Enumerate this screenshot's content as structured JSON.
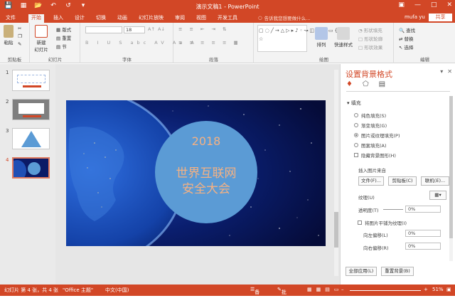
{
  "window": {
    "title": "演示文稿1 - PowerPoint",
    "user": "mufa yu",
    "share_label": "共享",
    "search_placeholder": "告诉我您想要做什么..."
  },
  "tabs": [
    "文件",
    "开始",
    "插入",
    "设计",
    "切换",
    "动画",
    "幻灯片放映",
    "审阅",
    "视图",
    "开发工具"
  ],
  "ribbon": {
    "groups": {
      "clipboard": "剪贴板",
      "slides": "幻灯片",
      "font": "字体",
      "paragraph": "段落",
      "drawing": "绘图",
      "editing": "编辑"
    },
    "paste_label": "粘贴",
    "new_slide_label": "新建\n幻灯片",
    "layout_label": "版式",
    "reset_label": "重置",
    "section_label": "节",
    "arrange_label": "排列",
    "quick_styles_label": "快速样式",
    "shape_fill_label": "形状填充",
    "shape_outline_label": "形状轮廓",
    "shape_effects_label": "形状效果",
    "find_label": "查找",
    "replace_label": "替换",
    "select_label": "选择",
    "font_size": "18"
  },
  "slides": [
    {
      "number": "1"
    },
    {
      "number": "2"
    },
    {
      "number": "3"
    },
    {
      "number": "4"
    }
  ],
  "slide": {
    "year": "2018",
    "line1": "世界互联网",
    "line2": "安全大会"
  },
  "format_pane": {
    "title": "设置背景格式",
    "fill_section": "填充",
    "options": [
      "纯色填充(S)",
      "渐变填充(G)",
      "图片或纹理填充(P)",
      "图案填充(A)"
    ],
    "selected_option": 2,
    "hide_bg": "隐藏背景图形(H)",
    "insert_from": "插入图片来自",
    "file_btn": "文件(F)...",
    "clipboard_btn": "剪贴板(C)",
    "online_btn": "联机(E)...",
    "texture_label": "纹理(U)",
    "transparency_label": "透明度(T)",
    "transparency_value": "0%",
    "tile_label": "将图片平铺为纹理(I)",
    "offset_left_label": "向左偏移(L)",
    "offset_left_value": "0%",
    "offset_right_label": "向右偏移(R)",
    "offset_right_value": "0%",
    "apply_all_btn": "全部应用(L)",
    "reset_bg_btn": "重置背景(B)"
  },
  "status": {
    "slide_info": "幻灯片 第 4 张，共 4 张",
    "theme": "\"Office 主题\"",
    "language": "中文(中国)",
    "notes": "备注",
    "comments": "批注",
    "zoom": "51%"
  },
  "colors": {
    "accent": "#d24726",
    "slide_circle": "#5b9bd5",
    "slide_text": "#f4b183"
  }
}
